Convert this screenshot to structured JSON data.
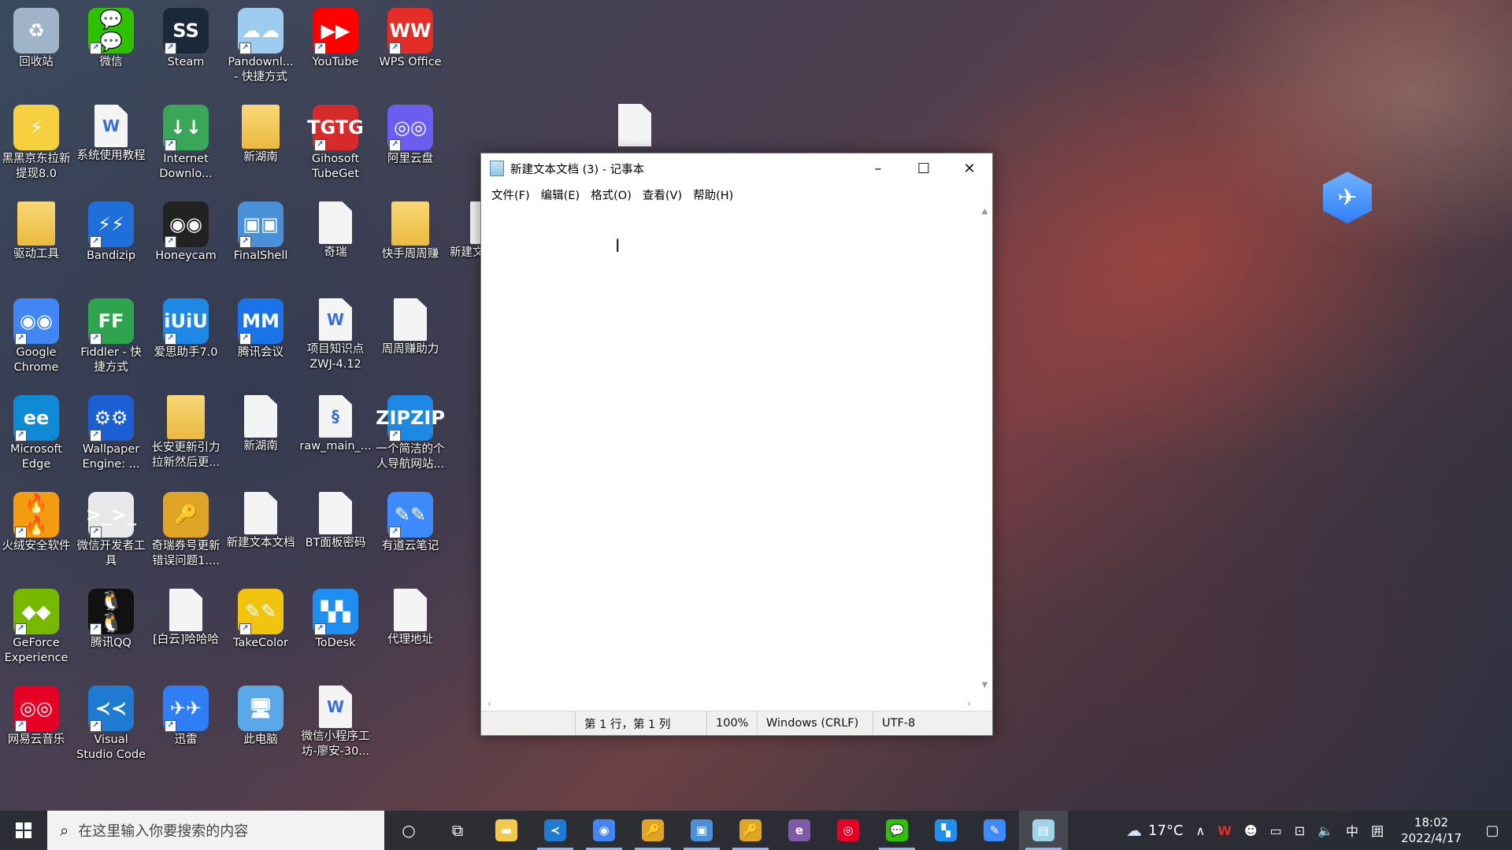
{
  "desktop_icons": [
    {
      "label": "回收站",
      "icon": "recycle-bin-icon",
      "color": "#9fb4c8",
      "glyph": "♻",
      "shortcut": false
    },
    {
      "label": "微信",
      "icon": "wechat-icon",
      "color": "#2dc100",
      "glyph": "💬",
      "shortcut": true
    },
    {
      "label": "Steam",
      "icon": "steam-icon",
      "color": "#1b2838",
      "glyph": "S",
      "shortcut": true
    },
    {
      "label": "Pandownl...\n- 快捷方式",
      "icon": "pandownload-icon",
      "color": "#9ecbf0",
      "glyph": "☁",
      "shortcut": true
    },
    {
      "label": "YouTube",
      "icon": "youtube-icon",
      "color": "#ff0000",
      "glyph": "▶",
      "shortcut": true
    },
    {
      "label": "WPS Office",
      "icon": "wps-office-icon",
      "color": "#e52d27",
      "glyph": "W",
      "shortcut": true
    },
    {
      "label": "黑黑京东拉新\n提现8.0",
      "icon": "pikachu-app-icon",
      "color": "#f4d03f",
      "glyph": "⚡",
      "shortcut": false
    },
    {
      "label": "系统使用教程",
      "icon": "word-document-icon",
      "color": "doc",
      "glyph": "W",
      "shortcut": false
    },
    {
      "label": "Internet\nDownlo...",
      "icon": "internet-download-manager-icon",
      "color": "#3aa657",
      "glyph": "↓",
      "shortcut": true
    },
    {
      "label": "新湖南",
      "icon": "folder-icon",
      "color": "folder",
      "glyph": "",
      "shortcut": false
    },
    {
      "label": "Gihosoft\nTubeGet",
      "icon": "tubeget-icon",
      "color": "#d62b2b",
      "glyph": "TG",
      "shortcut": true
    },
    {
      "label": "阿里云盘",
      "icon": "aliyun-drive-icon",
      "color": "#6a5df0",
      "glyph": "◎",
      "shortcut": true
    },
    {
      "label": "驱动工具",
      "icon": "folder-icon",
      "color": "folder",
      "glyph": "",
      "shortcut": false
    },
    {
      "label": "Bandizip",
      "icon": "bandizip-icon",
      "color": "#1e6fd9",
      "glyph": "⚡",
      "shortcut": true
    },
    {
      "label": "Honeycam",
      "icon": "honeycam-icon",
      "color": "#222222",
      "glyph": "◉",
      "shortcut": true
    },
    {
      "label": "FinalShell",
      "icon": "finalshell-icon",
      "color": "#4a90d9",
      "glyph": "▣",
      "shortcut": true
    },
    {
      "label": "奇瑞",
      "icon": "text-file-icon",
      "color": "doc",
      "glyph": "",
      "shortcut": false
    },
    {
      "label": "快手周周赚",
      "icon": "folder-icon",
      "color": "folder",
      "glyph": "",
      "shortcut": false
    },
    {
      "label": "Google\nChrome",
      "icon": "google-chrome-icon",
      "color": "#4285f4",
      "glyph": "◉",
      "shortcut": true
    },
    {
      "label": "Fiddler - 快\n捷方式",
      "icon": "fiddler-icon",
      "color": "#2ea44f",
      "glyph": "F",
      "shortcut": true
    },
    {
      "label": "爱思助手7.0",
      "icon": "i4-assistant-icon",
      "color": "#1e88e5",
      "glyph": "iU",
      "shortcut": true
    },
    {
      "label": "腾讯会议",
      "icon": "tencent-meeting-icon",
      "color": "#1a73e8",
      "glyph": "M",
      "shortcut": true
    },
    {
      "label": "项目知识点\nZWJ-4.12",
      "icon": "word-document-icon",
      "color": "doc",
      "glyph": "W",
      "shortcut": false
    },
    {
      "label": "周周赚助力",
      "icon": "text-file-icon",
      "color": "doc",
      "glyph": "",
      "shortcut": false
    },
    {
      "label": "Microsoft\nEdge",
      "icon": "microsoft-edge-icon",
      "color": "#0f8bd6",
      "glyph": "e",
      "shortcut": true
    },
    {
      "label": "Wallpaper\nEngine: ...",
      "icon": "wallpaper-engine-icon",
      "color": "#1c5fd4",
      "glyph": "⚙",
      "shortcut": true
    },
    {
      "label": "长安更新引力\n拉新然后更...",
      "icon": "folder-icon",
      "color": "folder",
      "glyph": "",
      "shortcut": false
    },
    {
      "label": "新湖南",
      "icon": "text-file-icon",
      "color": "doc",
      "glyph": "",
      "shortcut": false
    },
    {
      "label": "raw_main_...",
      "icon": "python-script-icon",
      "color": "doc",
      "glyph": "§",
      "shortcut": false
    },
    {
      "label": "一个简洁的个\n人导航网站...",
      "icon": "zip-archive-icon",
      "color": "#1e88e5",
      "glyph": "ZIP",
      "shortcut": true
    },
    {
      "label": "火绒安全软件",
      "icon": "huorong-security-icon",
      "color": "#f39c12",
      "glyph": "🔥",
      "shortcut": true
    },
    {
      "label": "微信开发者工\n具",
      "icon": "wechat-devtools-icon",
      "color": "#e8e8e8",
      "glyph": ">_",
      "shortcut": true
    },
    {
      "label": "奇瑞券号更新\n错误问题1....",
      "icon": "key-icon",
      "color": "#e0a526",
      "glyph": "🔑",
      "shortcut": false
    },
    {
      "label": "新建文本文档",
      "icon": "text-file-icon",
      "color": "doc",
      "glyph": "",
      "shortcut": false
    },
    {
      "label": "BT面板密码",
      "icon": "text-file-icon",
      "color": "doc",
      "glyph": "",
      "shortcut": false
    },
    {
      "label": "有道云笔记",
      "icon": "youdao-note-icon",
      "color": "#3d8bff",
      "glyph": "✎",
      "shortcut": true
    },
    {
      "label": "GeForce\nExperience",
      "icon": "geforce-experience-icon",
      "color": "#76b900",
      "glyph": "◆",
      "shortcut": true
    },
    {
      "label": "腾讯QQ",
      "icon": "tencent-qq-icon",
      "color": "#111111",
      "glyph": "🐧",
      "shortcut": true
    },
    {
      "label": "[白云]哈哈哈",
      "icon": "text-file-icon",
      "color": "doc",
      "glyph": "",
      "shortcut": false
    },
    {
      "label": "TakeColor",
      "icon": "takecolor-icon",
      "color": "#f1c40f",
      "glyph": "✎",
      "shortcut": true
    },
    {
      "label": "ToDesk",
      "icon": "todesk-icon",
      "color": "#1f8ef1",
      "glyph": "▚",
      "shortcut": true
    },
    {
      "label": "代理地址",
      "icon": "text-file-icon",
      "color": "doc",
      "glyph": "",
      "shortcut": false
    },
    {
      "label": "网易云音乐",
      "icon": "netease-music-icon",
      "color": "#e60026",
      "glyph": "◎",
      "shortcut": true
    },
    {
      "label": "Visual\nStudio Code",
      "icon": "vscode-icon",
      "color": "#1f7ad1",
      "glyph": "≺",
      "shortcut": true
    },
    {
      "label": "迅雷",
      "icon": "xunlei-icon",
      "color": "#2f7ef5",
      "glyph": "✈",
      "shortcut": true
    },
    {
      "label": "此电脑",
      "icon": "this-pc-icon",
      "color": "#5aa8e8",
      "glyph": "🖥",
      "shortcut": false
    },
    {
      "label": "微信小程序工\n坊-廖安-30...",
      "icon": "word-document-icon",
      "color": "doc",
      "glyph": "W",
      "shortcut": false
    }
  ],
  "partial_icon": {
    "label": "新建文"
  },
  "notepad": {
    "title": "新建文本文档 (3) - 记事本",
    "menu": [
      "文件(F)",
      "编辑(E)",
      "格式(O)",
      "查看(V)",
      "帮助(H)"
    ],
    "content": "",
    "status": {
      "position": "第 1 行，第 1 列",
      "zoom": "100%",
      "line_ending": "Windows (CRLF)",
      "encoding": "UTF-8"
    }
  },
  "taskbar": {
    "search_placeholder": "在这里输入你要搜索的内容",
    "apps": [
      {
        "name": "file-explorer-icon",
        "color": "#f2c94c",
        "glyph": "▬",
        "running": false,
        "active": false
      },
      {
        "name": "vscode-icon",
        "color": "#1f7ad1",
        "glyph": "≺",
        "running": true,
        "active": false
      },
      {
        "name": "google-chrome-icon",
        "color": "#4285f4",
        "glyph": "◉",
        "running": true,
        "active": false
      },
      {
        "name": "key-tool-icon",
        "color": "#e0a526",
        "glyph": "🔑",
        "running": true,
        "active": false
      },
      {
        "name": "finalshell-icon",
        "color": "#4a90d9",
        "glyph": "▣",
        "running": true,
        "active": false
      },
      {
        "name": "key-tool-2-icon",
        "color": "#e0a526",
        "glyph": "🔑",
        "running": true,
        "active": false
      },
      {
        "name": "ie-app-icon",
        "color": "#7d5ba6",
        "glyph": "e",
        "running": false,
        "active": false
      },
      {
        "name": "netease-music-icon",
        "color": "#e60026",
        "glyph": "◎",
        "running": false,
        "active": false
      },
      {
        "name": "wechat-icon",
        "color": "#2dc100",
        "glyph": "💬",
        "running": true,
        "active": false
      },
      {
        "name": "todesk-icon",
        "color": "#1f8ef1",
        "glyph": "▚",
        "running": false,
        "active": false
      },
      {
        "name": "youdao-note-icon",
        "color": "#3d8bff",
        "glyph": "✎",
        "running": false,
        "active": false
      },
      {
        "name": "notepad-icon",
        "color": "#9fd3e6",
        "glyph": "▤",
        "running": true,
        "active": true
      }
    ],
    "weather": "17°C",
    "ime": "中",
    "ime2": "囲",
    "time": "18:02",
    "date": "2022/4/17"
  }
}
